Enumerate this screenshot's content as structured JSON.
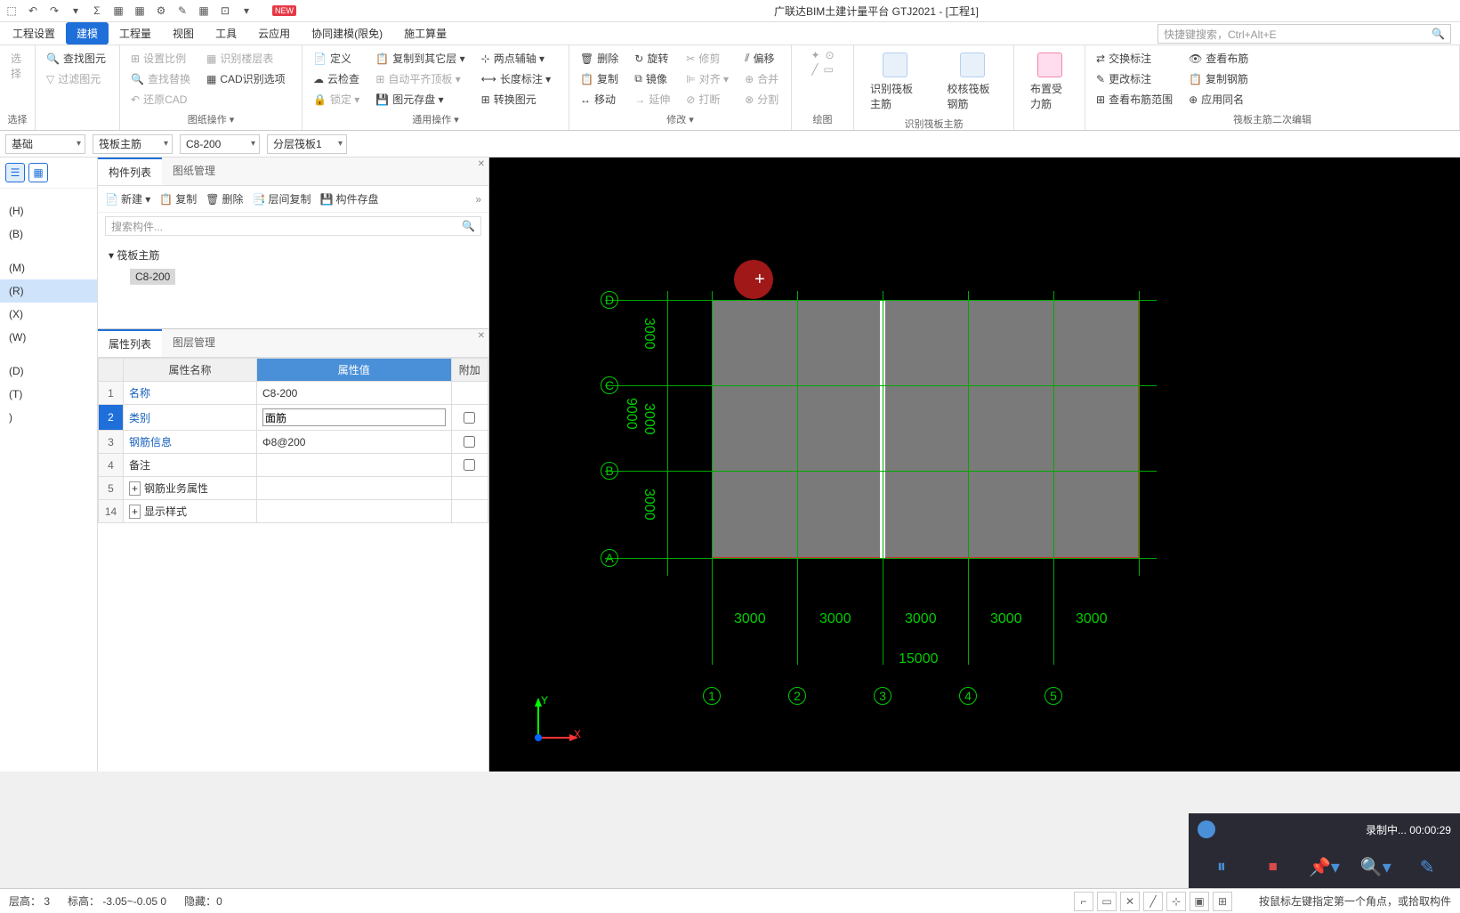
{
  "app": {
    "title": "广联达BIM土建计量平台 GTJ2021 - [工程1]",
    "new_badge": "NEW"
  },
  "qat": [
    "⬚",
    "↶",
    "↷",
    "▾",
    "Σ",
    "⊞",
    "⊞",
    "⚙",
    "✎",
    "⊞",
    "⊡",
    "▾"
  ],
  "menu": {
    "items": [
      "工程设置",
      "建模",
      "工程量",
      "视图",
      "工具",
      "云应用",
      "协同建模(限免)",
      "施工算量"
    ],
    "active": 1
  },
  "shortcut": {
    "placeholder": "快捷键搜索，Ctrl+Alt+E"
  },
  "ribbon": {
    "g1": {
      "label": "选择",
      "items": [
        "查找图元",
        "过滤图元"
      ]
    },
    "g2": {
      "label": "图纸操作 ▾",
      "items": [
        "设置比例",
        "识别楼层表",
        "查找替换",
        "CAD识别选项",
        "还原CAD"
      ]
    },
    "g3": {
      "label": "通用操作 ▾",
      "items": [
        "定义",
        "复制到其它层 ▾",
        "两点辅轴 ▾",
        "云检查",
        "自动平齐顶板 ▾",
        "长度标注 ▾",
        "锁定 ▾",
        "图元存盘 ▾",
        "转换图元"
      ]
    },
    "g4": {
      "label": "修改 ▾",
      "items": [
        "删除",
        "旋转",
        "修剪",
        "偏移",
        "复制",
        "镜像",
        "对齐 ▾",
        "合并",
        "移动",
        "延伸",
        "打断",
        "分割"
      ]
    },
    "g5": {
      "label": "绘图",
      "items": [
        "",
        "",
        ""
      ]
    },
    "g6": {
      "label": "识别筏板主筋",
      "items": [
        "识别筏板主筋",
        "校核筏板钢筋"
      ]
    },
    "g7": {
      "items": [
        "布置受力筋"
      ]
    },
    "g8": {
      "label": "筏板主筋二次编辑",
      "items": [
        "交换标注",
        "查看布筋",
        "更改标注",
        "复制钢筋",
        "查看布筋范围",
        "应用同名"
      ]
    }
  },
  "combos": [
    "基础",
    "筏板主筋",
    "C8-200",
    "分层筏板1"
  ],
  "leftnav": {
    "items": [
      "",
      "(H)",
      "(B)",
      "",
      "(M)",
      "(R)",
      "(X)",
      "(W)",
      "",
      "(D)",
      "(T)",
      ")"
    ],
    "sel": 5
  },
  "midpanel": {
    "tabs": [
      "构件列表",
      "图纸管理"
    ],
    "activeTab": 0,
    "toolbar": [
      "新建 ▾",
      "复制",
      "删除",
      "层间复制",
      "构件存盘"
    ],
    "search": "搜索构件...",
    "tree": {
      "root": "筏板主筋",
      "child": "C8-200"
    }
  },
  "proppanel": {
    "tabs": [
      "属性列表",
      "图层管理"
    ],
    "activeTab": 0,
    "headers": [
      "属性名称",
      "属性值",
      "附加"
    ],
    "rows": [
      {
        "n": "1",
        "name": "名称",
        "val": "C8-200",
        "link": true
      },
      {
        "n": "2",
        "name": "类别",
        "val": "面筋",
        "link": true,
        "sel": true,
        "input": true,
        "chk": true
      },
      {
        "n": "3",
        "name": "钢筋信息",
        "val": "Φ8@200",
        "link": true,
        "chk": true
      },
      {
        "n": "4",
        "name": "备注",
        "val": "",
        "chk": true
      },
      {
        "n": "5",
        "name": "钢筋业务属性",
        "val": "",
        "expand": "+"
      },
      {
        "n": "14",
        "name": "显示样式",
        "val": "",
        "expand": "+"
      }
    ]
  },
  "canvas": {
    "rowLabels": [
      "D",
      "C",
      "B",
      "A"
    ],
    "colLabels": [
      "1",
      "2",
      "3",
      "4",
      "5"
    ],
    "rowDims": [
      "3000",
      "3000",
      "3000"
    ],
    "rowTotal": "9000",
    "colDims": [
      "3000",
      "3000",
      "3000",
      "3000",
      "3000"
    ],
    "colTotal": "15000",
    "axes": {
      "x": "X",
      "y": "Y"
    }
  },
  "status": {
    "floor": "层高：  3",
    "elev": "标高：  -3.05~-0.05      0",
    "hidden": "隐藏：0",
    "hint": "按鼠标左键指定第一个角点，或拾取构件"
  },
  "recorder": {
    "text": "录制中... 00:00:29"
  }
}
